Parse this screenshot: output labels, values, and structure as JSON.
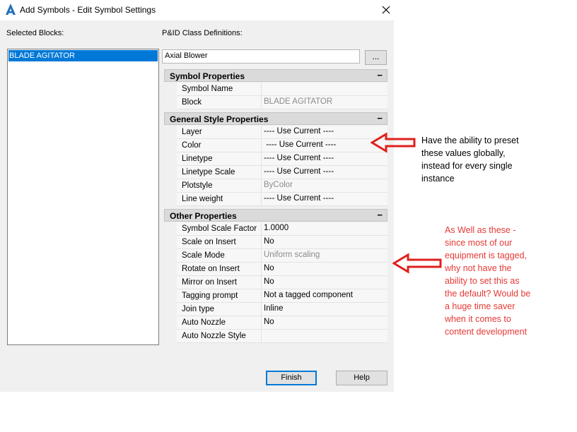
{
  "window": {
    "title": "Add Symbols - Edit Symbol Settings"
  },
  "labels": {
    "selected_blocks": "Selected Blocks:",
    "class_definitions": "P&ID Class Definitions:"
  },
  "selected_blocks": [
    "BLADE AGITATOR"
  ],
  "class_definition": {
    "value": "Axial Blower",
    "browse_label": "..."
  },
  "sections": {
    "symbol": {
      "title": "Symbol Properties",
      "toggle": "−",
      "rows": [
        {
          "key": "Symbol Name",
          "value": ""
        },
        {
          "key": "Block",
          "value": "BLADE AGITATOR"
        }
      ]
    },
    "general": {
      "title": "General Style Properties",
      "toggle": "−",
      "rows": [
        {
          "key": "Layer",
          "value": "---- Use Current ----"
        },
        {
          "key": "Color",
          "value": " ---- Use Current ----"
        },
        {
          "key": "Linetype",
          "value": "---- Use Current ----"
        },
        {
          "key": "Linetype Scale",
          "value": "---- Use Current ----"
        },
        {
          "key": "Plotstyle",
          "value": "ByColor"
        },
        {
          "key": "Line weight",
          "value": "---- Use Current ----"
        }
      ]
    },
    "other": {
      "title": "Other Properties",
      "toggle": "−",
      "rows": [
        {
          "key": "Symbol Scale Factor",
          "value": "1.0000"
        },
        {
          "key": "Scale on Insert",
          "value": "No"
        },
        {
          "key": "Scale Mode",
          "value": "Uniform scaling"
        },
        {
          "key": "Rotate on Insert",
          "value": "No"
        },
        {
          "key": "Mirror on Insert",
          "value": "No"
        },
        {
          "key": "Tagging prompt",
          "value": "Not a tagged component"
        },
        {
          "key": "Join type",
          "value": "Inline"
        },
        {
          "key": "Auto Nozzle",
          "value": "No"
        },
        {
          "key": "Auto Nozzle Style",
          "value": ""
        }
      ]
    }
  },
  "buttons": {
    "finish": "Finish",
    "help": "Help"
  },
  "annotations": {
    "note1": [
      "Have the ability to preset",
      "these values globally,",
      "instead for every single",
      "instance"
    ],
    "note2": [
      "As Well as these -",
      "since most of our",
      "equipment is tagged,",
      "why not have the",
      "ability to set this as",
      "the default? Would be",
      "a huge time saver",
      "when it comes to",
      "content development"
    ],
    "note1_color": "#000000",
    "note2_color": "#e53935",
    "arrow_color": "#e0201c"
  },
  "icons": {
    "app": "autocad-a-icon",
    "close": "close-icon"
  }
}
